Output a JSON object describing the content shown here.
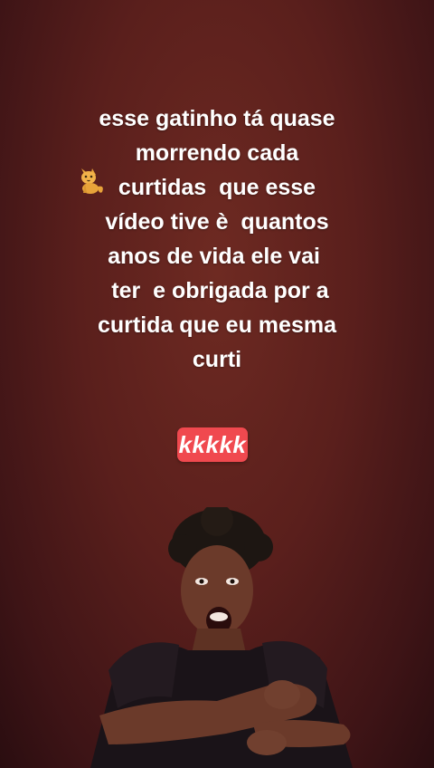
{
  "story": {
    "caption_lines": [
      "esse gatinho tá quase",
      "morrendo cada",
      "curtidas  que esse",
      "vídeo tive è  quantos",
      "anos de vida ele vai ",
      " ter  e obrigada por a",
      "curtida que eu mesma",
      "curti"
    ],
    "cat_emoji_icon": "cat-emoji",
    "sticker_text": "kkkkk",
    "sticker_color": "#f0494f",
    "gif_icon": "dancing-woman-gif"
  }
}
